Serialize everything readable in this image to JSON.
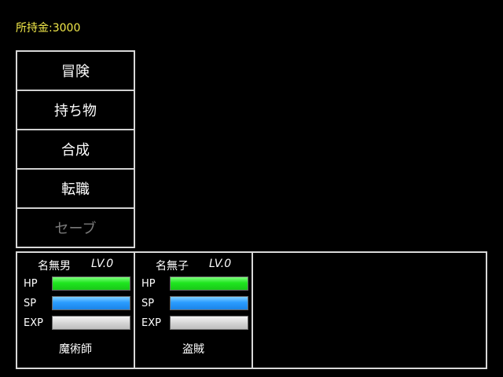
{
  "gold": "所持金:3000",
  "menu": {
    "items": [
      {
        "label": "冒険",
        "enabled": true
      },
      {
        "label": "持ち物",
        "enabled": true
      },
      {
        "label": "合成",
        "enabled": true
      },
      {
        "label": "転職",
        "enabled": true
      },
      {
        "label": "セーブ",
        "enabled": false
      }
    ]
  },
  "party": {
    "members": [
      {
        "name": "名無男",
        "level": "LV.0",
        "stats": {
          "hp_label": "HP",
          "sp_label": "SP",
          "exp_label": "EXP"
        },
        "hp_fraction": 1.0,
        "sp_fraction": 1.0,
        "exp_fraction": 1.0,
        "class": "魔術師"
      },
      {
        "name": "名無子",
        "level": "LV.0",
        "stats": {
          "hp_label": "HP",
          "sp_label": "SP",
          "exp_label": "EXP"
        },
        "hp_fraction": 1.0,
        "sp_fraction": 1.0,
        "exp_fraction": 1.0,
        "class": "盗賊"
      }
    ]
  },
  "colors": {
    "gold_text": "#f2e94a",
    "hp_bar": "#1fe61f",
    "sp_bar": "#2a9cff",
    "exp_bar": "#d6d6d6",
    "disabled_text": "#7a7a7a"
  }
}
